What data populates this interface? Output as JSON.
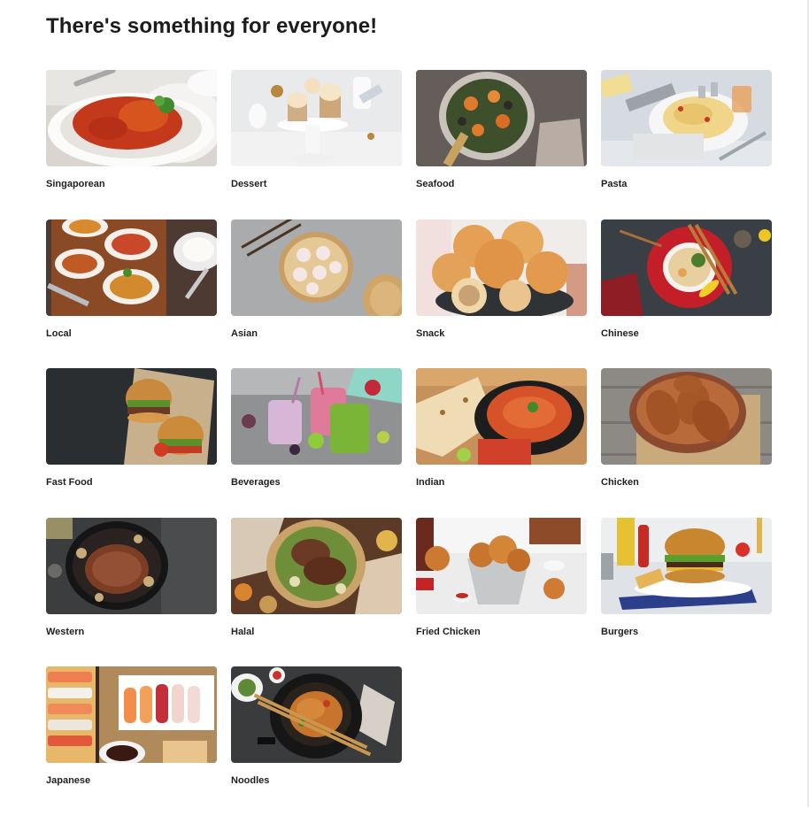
{
  "page": {
    "title": "There's something for everyone!"
  },
  "categories": [
    {
      "label": "Singaporean",
      "icon": "chilli-crab-photo"
    },
    {
      "label": "Dessert",
      "icon": "cupcakes-photo"
    },
    {
      "label": "Seafood",
      "icon": "seafood-pan-photo"
    },
    {
      "label": "Pasta",
      "icon": "pasta-plate-photo"
    },
    {
      "label": "Local",
      "icon": "curry-dishes-photo"
    },
    {
      "label": "Asian",
      "icon": "dim-sum-photo"
    },
    {
      "label": "Snack",
      "icon": "buns-photo"
    },
    {
      "label": "Chinese",
      "icon": "noodle-bowl-photo"
    },
    {
      "label": "Fast Food",
      "icon": "burgers-photo"
    },
    {
      "label": "Beverages",
      "icon": "smoothies-photo"
    },
    {
      "label": "Indian",
      "icon": "curry-naan-photo"
    },
    {
      "label": "Chicken",
      "icon": "roast-chicken-photo"
    },
    {
      "label": "Western",
      "icon": "steak-skillet-photo"
    },
    {
      "label": "Halal",
      "icon": "grilled-meat-photo"
    },
    {
      "label": "Fried Chicken",
      "icon": "fried-chicken-photo"
    },
    {
      "label": "Burgers",
      "icon": "cheeseburger-photo"
    },
    {
      "label": "Japanese",
      "icon": "sushi-photo"
    },
    {
      "label": "Noodles",
      "icon": "wok-noodles-photo"
    }
  ]
}
